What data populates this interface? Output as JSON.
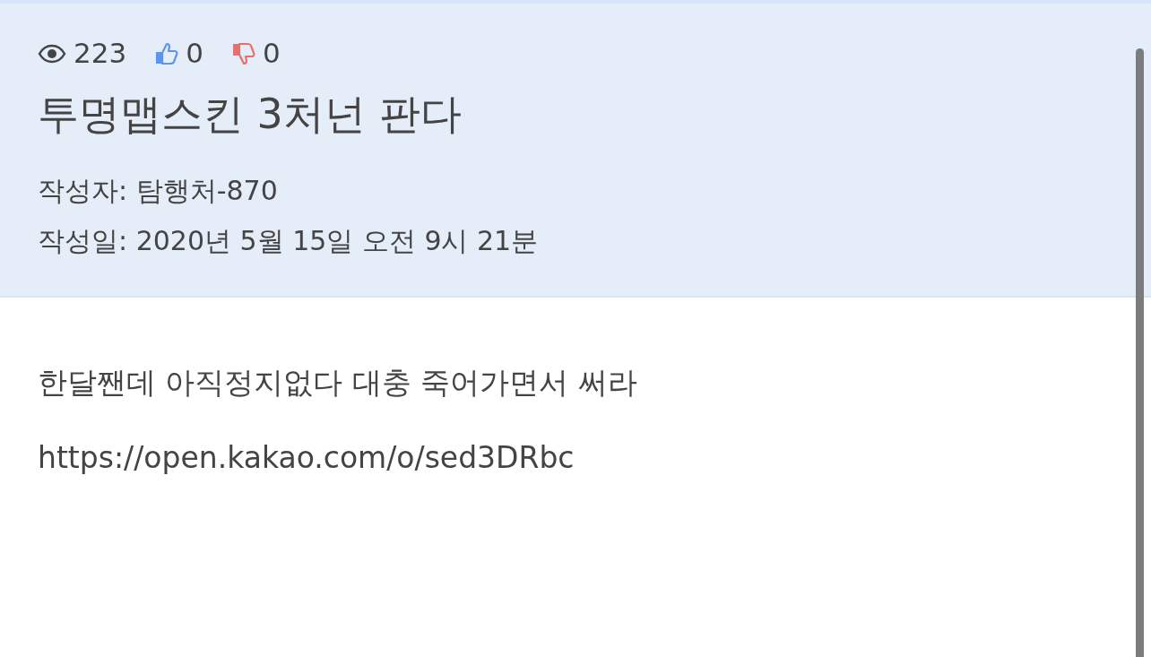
{
  "stats": {
    "views": "223",
    "likes": "0",
    "dislikes": "0"
  },
  "title": "투명맵스킨 3처넌 판다",
  "meta": [
    "작성자: 탐행처-870",
    "작성일: 2020년 5월 15일 오전 9시 21분"
  ],
  "body": [
    "한달짼데 아직정지없다 대충 죽어가면서 써라",
    "https://open.kakao.com/o/sed3DRbc"
  ]
}
